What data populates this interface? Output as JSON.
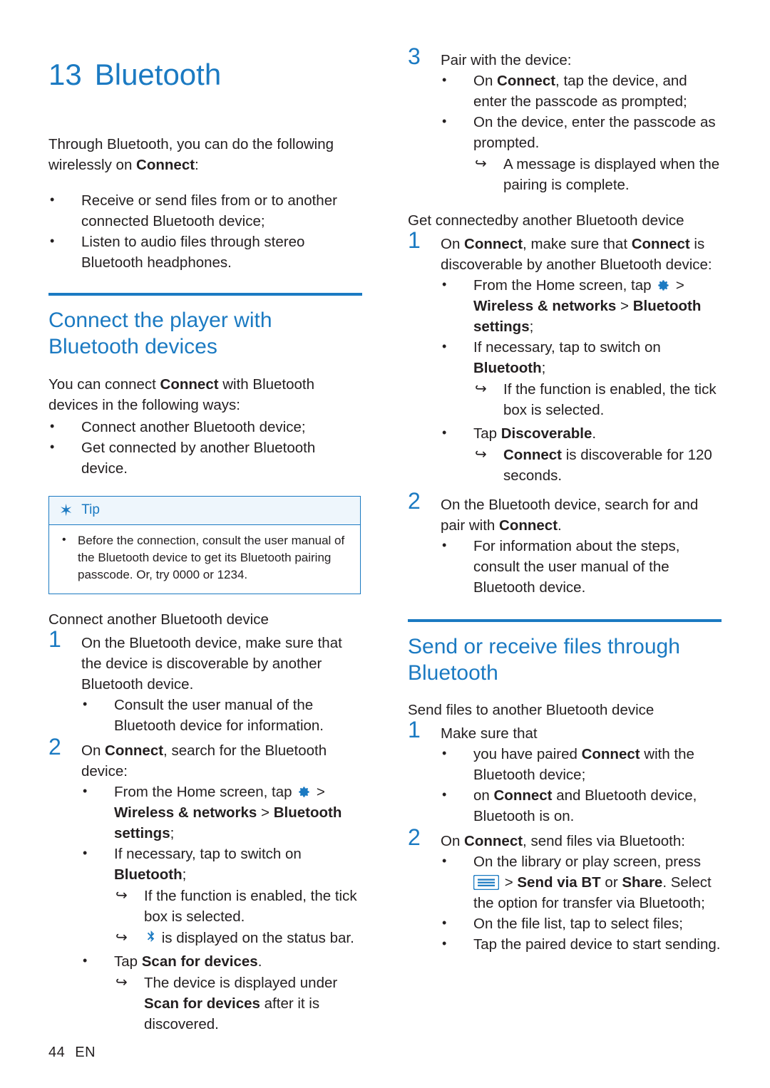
{
  "chapter": {
    "number": "13",
    "title": "Bluetooth"
  },
  "left": {
    "intro_1": "Through Bluetooth, you can do the following",
    "intro_2_pre": "wirelessly on ",
    "intro_2_bold": "Connect",
    "intro_2_post": ":",
    "intro_bullets": [
      "Receive or send files from or to another connected Bluetooth device;",
      "Listen to audio files through stereo Bluetooth headphones."
    ],
    "section_title_line1": "Connect the player with",
    "section_title_line2": "Bluetooth devices",
    "connect_para_pre": "You can connect ",
    "connect_para_bold": "Connect",
    "connect_para_post": " with Bluetooth devices in the following ways:",
    "connect_bullets": [
      "Connect another Bluetooth device;",
      "Get connected by another Bluetooth device."
    ],
    "tip": {
      "label": "Tip",
      "text": "Before the connection, consult the user manual of the Bluetooth device to get its Bluetooth pairing passcode. Or, try 0000 or 1234."
    },
    "sub_heading": "Connect another Bluetooth device",
    "step1_num": "1",
    "step1_text": "On the Bluetooth device, make sure that the device is discoverable by another Bluetooth device.",
    "step1_bullet": "Consult the user manual of the Bluetooth device for information.",
    "step2_num": "2",
    "step2_pre": "On ",
    "step2_bold": "Connect",
    "step2_post": ", search for the Bluetooth device:",
    "step2_b1_pre": "From the Home screen, tap",
    "step2_b1_post": ">",
    "step2_b1_bold1": "Wireless & networks",
    "step2_b1_sep": " > ",
    "step2_b1_bold2": "Bluetooth settings",
    "step2_b1_semi": ";",
    "step2_b2_pre": "If necessary, tap to switch on ",
    "step2_b2_bold": "Bluetooth",
    "step2_b2_post": ";",
    "step2_arrow1": "If the function is enabled, the tick box is selected.",
    "step2_arrow2_post": "is displayed on the status bar.",
    "step2_b3_pre": "Tap ",
    "step2_b3_bold": "Scan for devices",
    "step2_b3_post": ".",
    "step2_arrow3_pre": "The device is displayed under ",
    "step2_arrow3_bold": "Scan for devices",
    "step2_arrow3_post": " after it is discovered."
  },
  "right": {
    "step3_num": "3",
    "step3_text": "Pair with the device:",
    "step3_b1_pre": "On ",
    "step3_b1_bold": "Connect",
    "step3_b1_post": ", tap the device, and enter the passcode as prompted;",
    "step3_b2": "On the device, enter the passcode as prompted.",
    "step3_arrow": "A message is displayed when the pairing is complete.",
    "sub_heading_get": "Get connectedby another Bluetooth device",
    "g1_num": "1",
    "g1_pre": "On ",
    "g1_bold1": "Connect",
    "g1_mid": ", make sure that ",
    "g1_bold2": "Connect",
    "g1_post": " is discoverable by another Bluetooth device:",
    "g1_b1_pre": "From the Home screen, tap",
    "g1_b1_post": ">",
    "g1_b1_bold1": "Wireless & networks",
    "g1_b1_sep": " > ",
    "g1_b1_bold2": "Bluetooth settings",
    "g1_b1_semi": ";",
    "g1_b2_pre": "If necessary, tap to switch on ",
    "g1_b2_bold": "Bluetooth",
    "g1_b2_post": ";",
    "g1_arrow1": "If the function is enabled, the tick box is selected.",
    "g1_b3_pre": "Tap ",
    "g1_b3_bold": "Discoverable",
    "g1_b3_post": ".",
    "g1_arrow2_bold": "Connect",
    "g1_arrow2_post": " is discoverable for 120 seconds.",
    "g2_num": "2",
    "g2_pre": "On the Bluetooth device, search for and pair with ",
    "g2_bold": "Connect",
    "g2_post": ".",
    "g2_b1": "For information about the steps, consult the user manual of the Bluetooth device.",
    "section2_title_line1": "Send or receive files through",
    "section2_title_line2": "Bluetooth",
    "sub_heading_send": "Send files to another Bluetooth device",
    "s1_num": "1",
    "s1_text": "Make sure that",
    "s1_b1_pre": "you have paired ",
    "s1_b1_bold": "Connect",
    "s1_b1_post": " with the Bluetooth device;",
    "s1_b2_pre": "on ",
    "s1_b2_bold": "Connect",
    "s1_b2_post": " and Bluetooth device, Bluetooth is on.",
    "s2_num": "2",
    "s2_pre": "On ",
    "s2_bold": "Connect",
    "s2_post": ", send files via Bluetooth:",
    "s2_b1": "On the library or play screen, press",
    "s2_b1_sep": "> ",
    "s2_b1_bold1": "Send via BT",
    "s2_b1_or": " or ",
    "s2_b1_bold2": "Share",
    "s2_b1_tail": ". Select the option for transfer via Bluetooth;",
    "s2_b2": "On the file list, tap to select files;",
    "s2_b3": "Tap the paired device to start sending."
  },
  "footer": {
    "page": "44",
    "lang": "EN"
  },
  "colors": {
    "accent": "#1b7ac2",
    "text": "#231f20"
  }
}
